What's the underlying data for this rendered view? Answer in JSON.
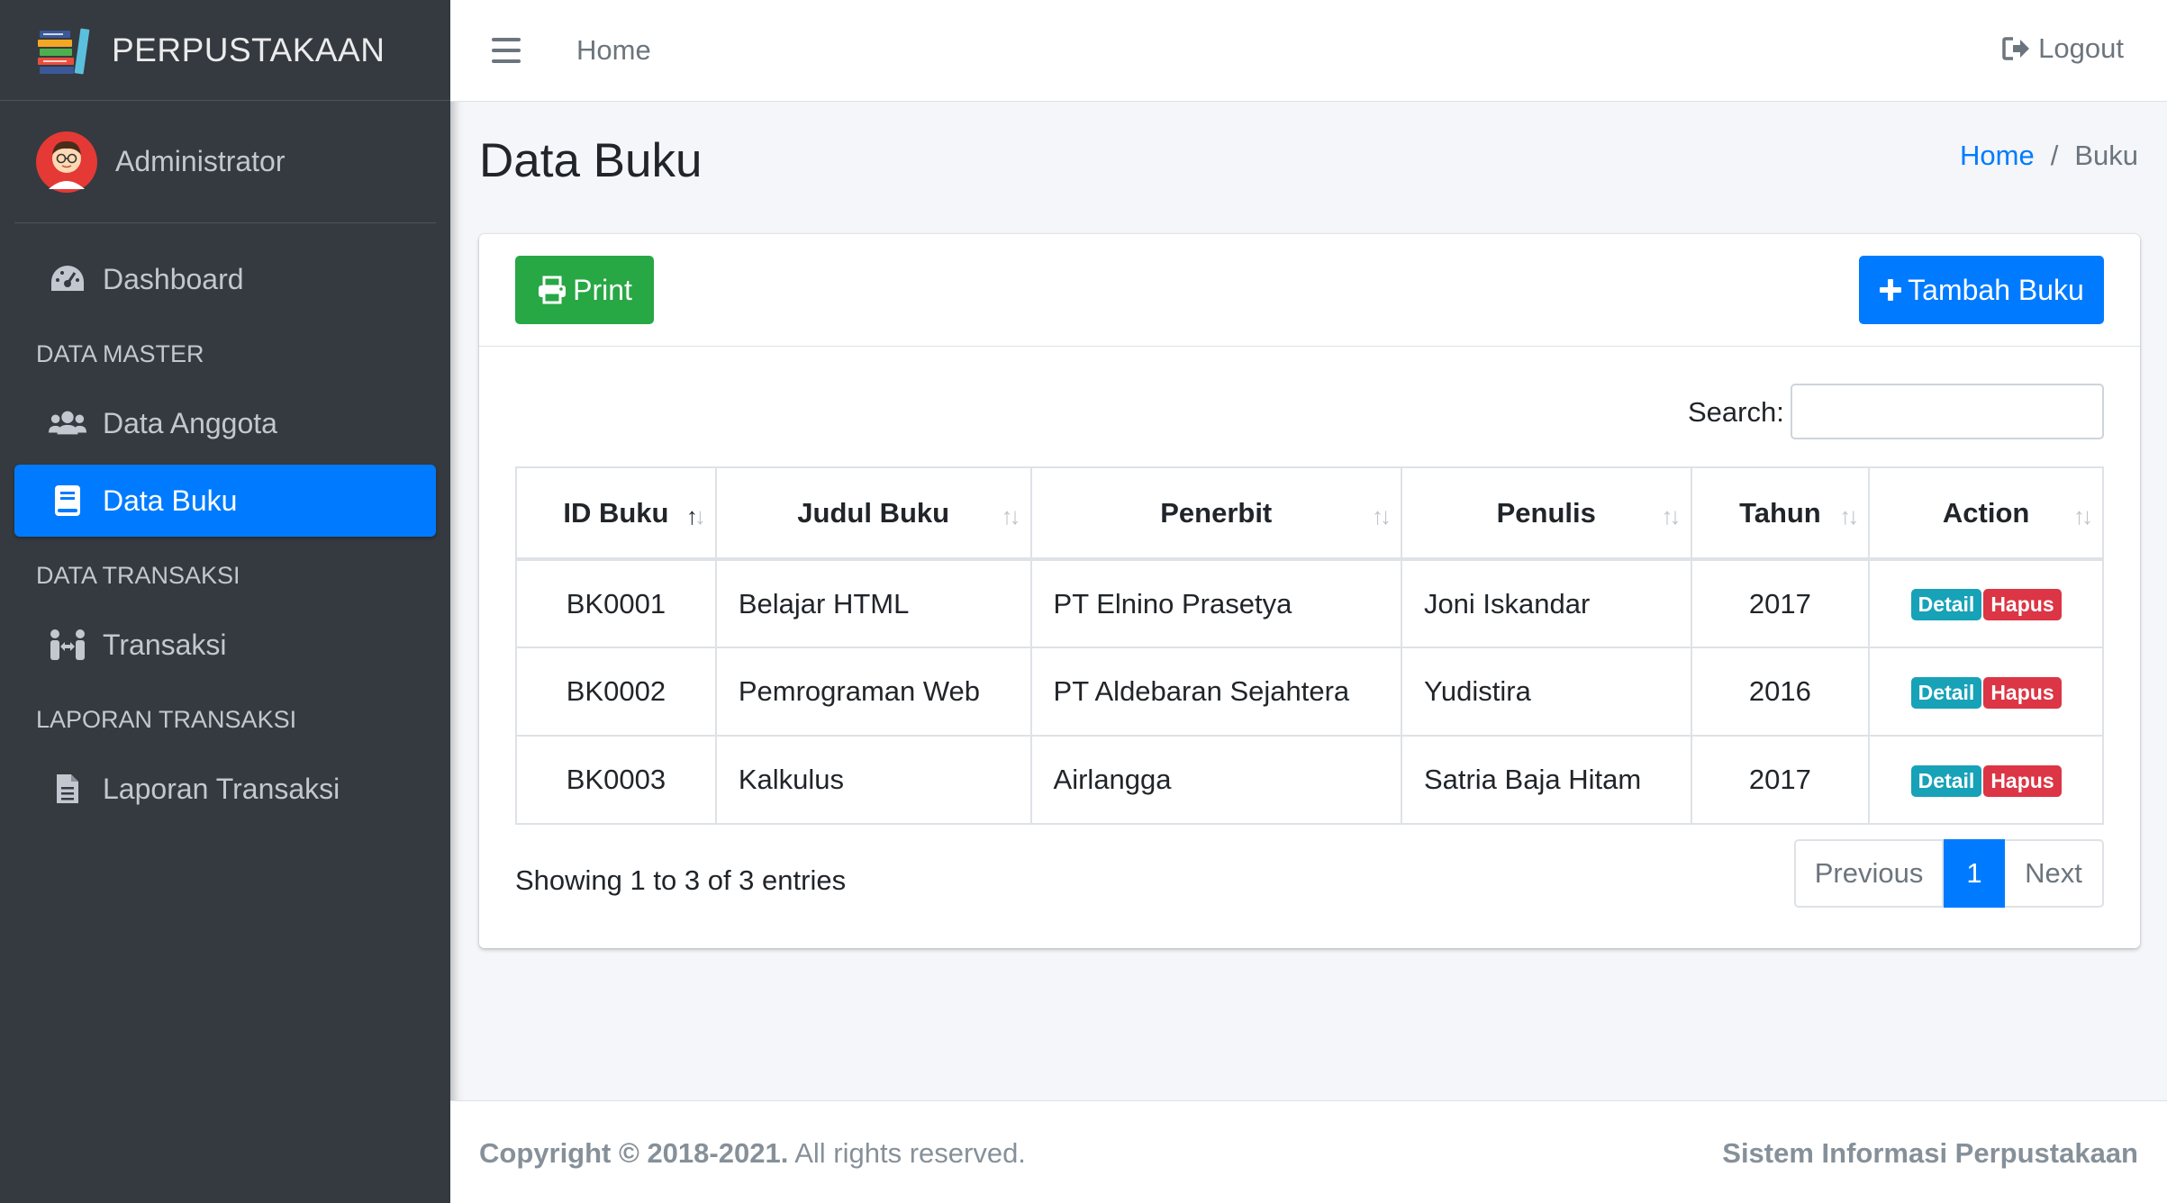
{
  "brand": {
    "name": "PERPUSTAKAAN"
  },
  "user": {
    "name": "Administrator"
  },
  "sidebar": {
    "items": [
      {
        "type": "link",
        "label": "Dashboard",
        "icon": "dashboard-gauge-icon"
      },
      {
        "type": "header",
        "label": "DATA MASTER"
      },
      {
        "type": "link",
        "label": "Data Anggota",
        "icon": "users-icon"
      },
      {
        "type": "link",
        "label": "Data Buku",
        "icon": "book-icon",
        "active": true
      },
      {
        "type": "header",
        "label": "DATA TRANSAKSI"
      },
      {
        "type": "link",
        "label": "Transaksi",
        "icon": "people-arrows-icon"
      },
      {
        "type": "header",
        "label": "LAPORAN TRANSAKSI"
      },
      {
        "type": "link",
        "label": "Laporan Transaksi",
        "icon": "file-icon"
      }
    ]
  },
  "topbar": {
    "home_label": "Home",
    "logout_label": "Logout"
  },
  "page": {
    "title": "Data Buku"
  },
  "breadcrumb": {
    "home": "Home",
    "separator": "/",
    "current": "Buku"
  },
  "toolbar": {
    "print_label": "Print",
    "add_label": "Tambah Buku"
  },
  "search": {
    "label": "Search:",
    "value": ""
  },
  "table": {
    "columns": [
      "ID Buku",
      "Judul Buku",
      "Penerbit",
      "Penulis",
      "Tahun",
      "Action"
    ],
    "rows": [
      {
        "id": "BK0001",
        "judul": "Belajar HTML",
        "penerbit": "PT Elnino Prasetya",
        "penulis": "Joni Iskandar",
        "tahun": "2017"
      },
      {
        "id": "BK0002",
        "judul": "Pemrograman Web",
        "penerbit": "PT Aldebaran Sejahtera",
        "penulis": "Yudistira",
        "tahun": "2016"
      },
      {
        "id": "BK0003",
        "judul": "Kalkulus",
        "penerbit": "Airlangga",
        "penulis": "Satria Baja Hitam",
        "tahun": "2017"
      }
    ],
    "detail_label": "Detail",
    "delete_label": "Hapus",
    "sort_column": "ID Buku",
    "sort_direction": "ascending"
  },
  "pagination": {
    "info": "Showing 1 to 3 of 3 entries",
    "previous": "Previous",
    "current_page": "1",
    "next": "Next"
  },
  "footer": {
    "copyright_bold": "Copyright © 2018-2021.",
    "copyright_rest": " All rights reserved.",
    "app_name": "Sistem Informasi Perpustakaan"
  },
  "colors": {
    "sidebar_bg": "#343a40",
    "primary": "#007bff",
    "success": "#28a745",
    "info": "#17a2b8",
    "danger": "#dc3545",
    "page_bg": "#f4f6f9"
  }
}
